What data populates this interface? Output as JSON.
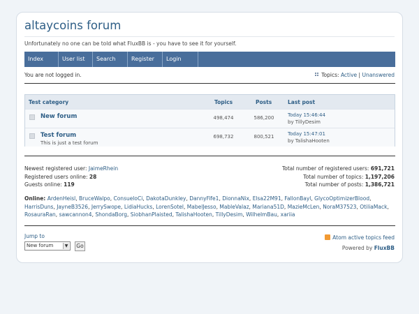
{
  "title": "altaycoins forum",
  "description": "Unfortunately no one can be told what FluxBB is - you have to see it for yourself.",
  "nav": [
    "Index",
    "User list",
    "Search",
    "Register",
    "Login"
  ],
  "status": {
    "not_logged_in": "You are not logged in.",
    "topics_label": "Topics:",
    "active": "Active",
    "separator": "|",
    "unanswered": "Unanswered"
  },
  "table": {
    "category": "Test category",
    "col_topics": "Topics",
    "col_posts": "Posts",
    "col_last_post": "Last post",
    "forums": [
      {
        "name": "New forum",
        "desc": "",
        "topics": "498,474",
        "posts": "586,200",
        "last_time": "Today 15:46:44",
        "last_by": "by TillyDesim"
      },
      {
        "name": "Test forum",
        "desc": "This is just a test forum",
        "topics": "698,732",
        "posts": "800,521",
        "last_time": "Today 15:47:01",
        "last_by": "by TalishaHooten"
      }
    ]
  },
  "stats": {
    "newest_label": "Newest registered user:",
    "newest_user": "JaimeRhein",
    "reg_online_label": "Registered users online:",
    "reg_online": "28",
    "guests_label": "Guests online:",
    "guests": "119",
    "total_users_label": "Total number of registered users:",
    "total_users": "691,721",
    "total_topics_label": "Total number of topics:",
    "total_topics": "1,197,206",
    "total_posts_label": "Total number of posts:",
    "total_posts": "1,386,721"
  },
  "online": {
    "label": "Online:",
    "users": [
      "ArdenHeisl",
      "BruceWalpo",
      "ConsueloCi",
      "DakotaDunkley",
      "DannyFife1",
      "DionnaNix",
      "Elsa22M91",
      "FallonBayl",
      "GlycoOptimizerBlood",
      "HarrisDuns",
      "JayneB3526",
      "JerrySwope",
      "LidiaHucks",
      "LorenSotel",
      "MabelJesso",
      "MableValaz",
      "Mariana51D",
      "MazieMcLen",
      "NoraM37523",
      "OtiliaMack",
      "RosauraRan",
      "sawcannon4",
      "ShondaBorg",
      "SiobhanPlaisted",
      "TalishaHooten",
      "TillyDesim",
      "WilhelmBau",
      "xariia"
    ]
  },
  "footer": {
    "jump_label": "Jump to",
    "jump_value": "New forum",
    "go": "Go",
    "feed": "Atom active topics feed",
    "powered_by": "Powered by",
    "fluxbb": "FluxBB"
  }
}
